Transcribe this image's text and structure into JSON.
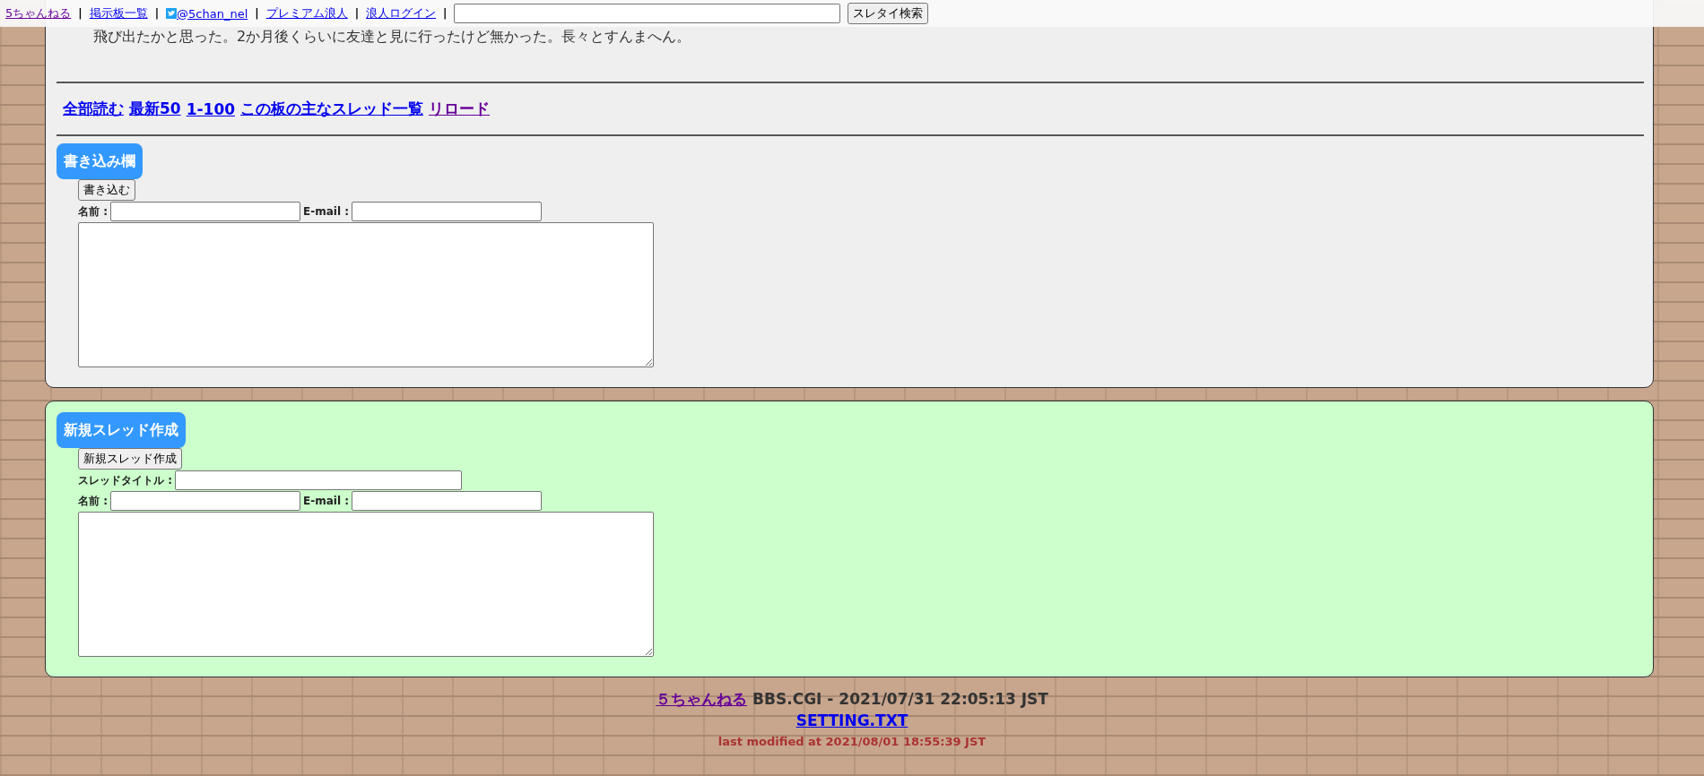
{
  "top_bar": {
    "items": [
      {
        "kind": "link",
        "label": "5ちゃんねる",
        "visited": true
      },
      {
        "kind": "separator",
        "text": "|"
      },
      {
        "kind": "link",
        "label": "掲示板一覧",
        "visited": false
      },
      {
        "kind": "separator",
        "text": "|"
      },
      {
        "kind": "twitter",
        "label": " @5chan_nel",
        "visited": false
      },
      {
        "kind": "separator",
        "text": "|"
      },
      {
        "kind": "link",
        "label": "プレミアム浪人",
        "visited": false
      },
      {
        "kind": "separator",
        "text": "|"
      },
      {
        "kind": "link",
        "label": "浪人ログイン",
        "visited": false
      },
      {
        "kind": "separator",
        "text": "|"
      }
    ],
    "search_button": "スレタイ検索"
  },
  "thread": {
    "text": "飛び出たかと思った。2か月後くらいに友達と見に行ったけど無かった。長々とすんまへん。",
    "nav_links": [
      {
        "label": "全部読む",
        "visited": false
      },
      {
        "label": "最新50",
        "visited": false
      },
      {
        "label": "1-100",
        "visited": false
      },
      {
        "label": "この板の主なスレッド一覧",
        "visited": false
      },
      {
        "label": "リロード",
        "visited": true
      }
    ],
    "form": {
      "heading": "書き込み欄",
      "submit": "書き込む",
      "name_label": "名前 :",
      "email_label": "E-mail :"
    }
  },
  "new_thread": {
    "heading": "新規スレッド作成",
    "submit": "新規スレッド作成",
    "title_label": "スレッドタイトル :",
    "name_label": "名前 :",
    "email_label": "E-mail :"
  },
  "footer": {
    "site_link": {
      "label": "５ちゃんねる",
      "visited": true
    },
    "version": "BBS.CGI - 2021/07/31 22:05:13 JST",
    "setting_link": {
      "label": "SETTING.TXT",
      "visited": false
    },
    "modified": "last modified at 2021/08/01 18:55:39 JST"
  }
}
